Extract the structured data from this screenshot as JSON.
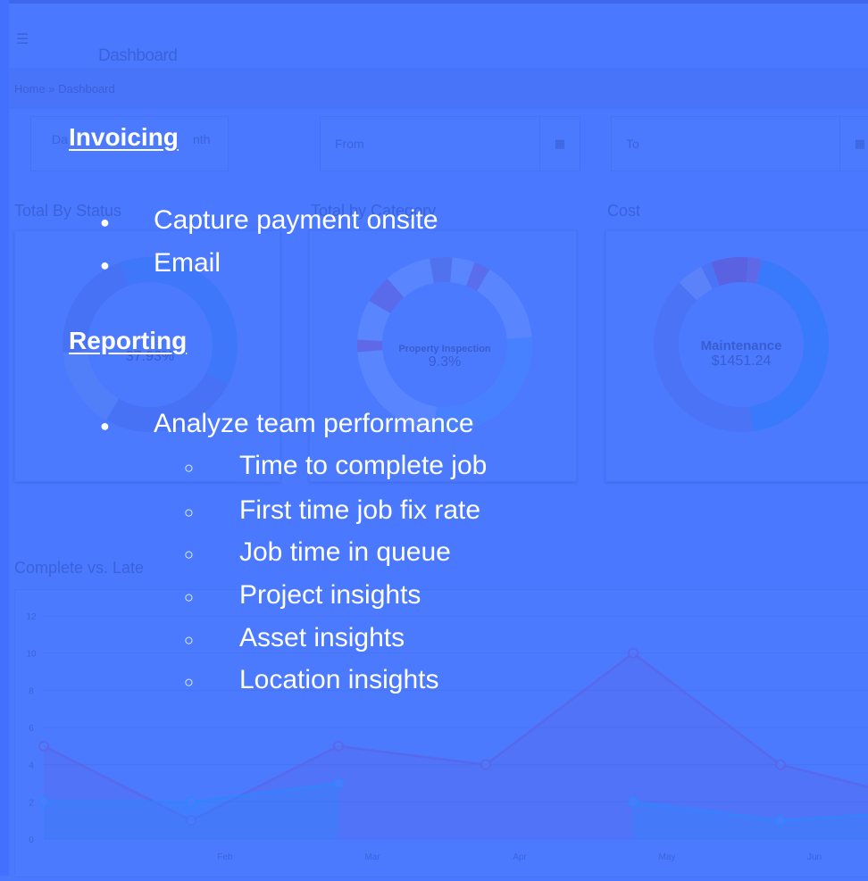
{
  "dashboard": {
    "menu_icon": "hamburger-icon",
    "title": "Dashboard",
    "breadcrumb": "Home » Dashboard",
    "range_buttons": [
      "Da",
      "nth"
    ],
    "from_placeholder": "From",
    "to_placeholder": "To",
    "calendar_icon": "calendar-icon"
  },
  "cards": {
    "status": {
      "label": "Total By Status",
      "center_value": "37.93%"
    },
    "category": {
      "label": "Total by Category",
      "center_title": "Property Inspection",
      "center_value": "9.3%"
    },
    "cost": {
      "label": "Cost",
      "center_title": "Maintenance",
      "center_value": "$1451.24"
    }
  },
  "chart_data": {
    "type": "area",
    "title": "Complete vs. Late",
    "categories": [
      "",
      "Feb",
      "Mar",
      "Apr",
      "May",
      "Jun",
      ""
    ],
    "ylim": [
      0,
      12
    ],
    "yticks": [
      0,
      2,
      4,
      6,
      8,
      10,
      12
    ],
    "series": [
      {
        "name": "",
        "values": [
          5,
          1,
          5,
          4,
          10,
          4,
          2
        ],
        "color": "#5b64e6"
      },
      {
        "name": "",
        "values": [
          2,
          2,
          3,
          null,
          2,
          1,
          1.5
        ],
        "color": "#2e86ff"
      }
    ]
  },
  "overlay": {
    "invoicing": {
      "heading": "Invoicing",
      "items": [
        "Capture payment onsite",
        "Email"
      ]
    },
    "reporting": {
      "heading": "Reporting",
      "items": [
        "Analyze team performance"
      ],
      "subitems": [
        "Time to complete job",
        "First time job fix rate",
        "Job time in queue",
        "Project insights",
        "Asset insights",
        "Location insights"
      ]
    }
  }
}
